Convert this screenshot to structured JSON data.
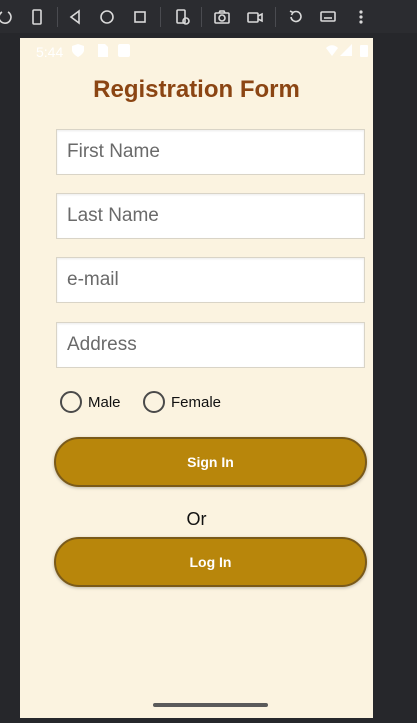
{
  "status_bar": {
    "time": "5:44"
  },
  "form": {
    "title": "Registration Form",
    "first_name_placeholder": "First Name",
    "last_name_placeholder": "Last Name",
    "email_placeholder": "e-mail",
    "address_placeholder": "Address",
    "gender_options": [
      "Male",
      "Female"
    ],
    "sign_in_label": "Sign In",
    "or_label": "Or",
    "log_in_label": "Log In"
  },
  "colors": {
    "screen_background": "#fbf3e0",
    "title": "#8b4513",
    "button": "#b8860b",
    "button_border": "#7a5a1a"
  }
}
